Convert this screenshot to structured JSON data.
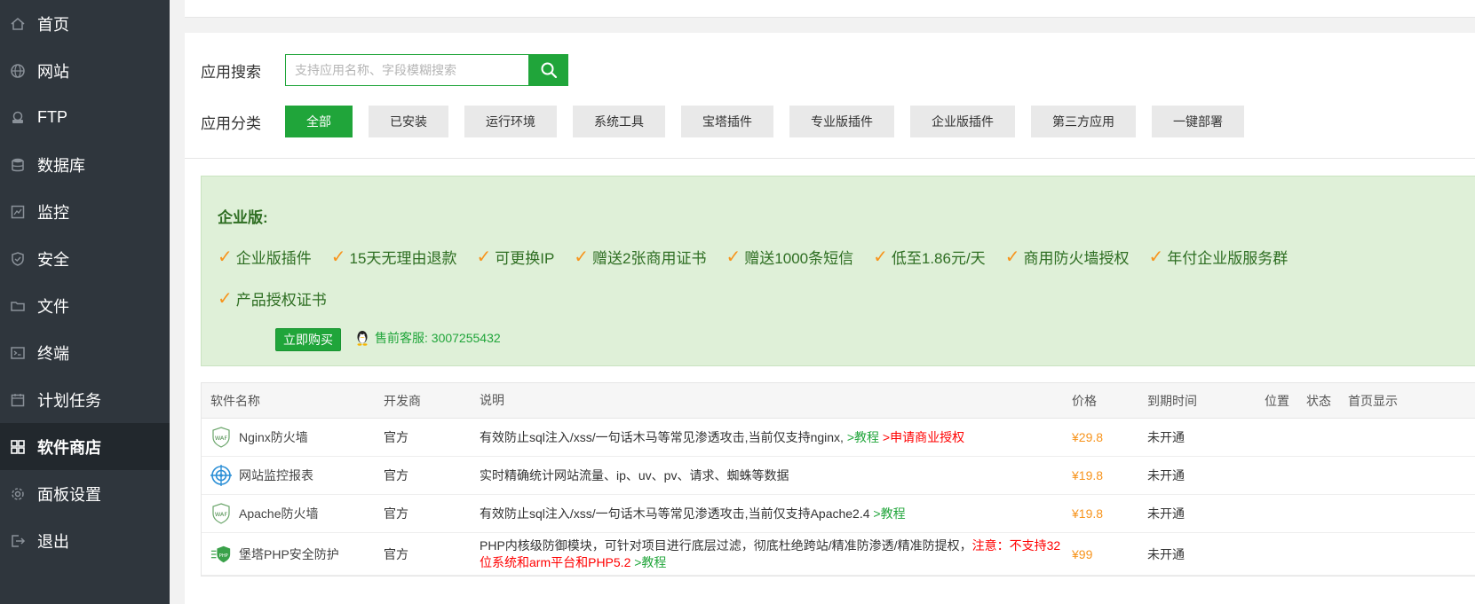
{
  "sidebar": {
    "items": [
      {
        "label": "首页",
        "icon": "home-icon",
        "key": "home"
      },
      {
        "label": "网站",
        "icon": "globe-icon",
        "key": "website"
      },
      {
        "label": "FTP",
        "icon": "ftp-icon",
        "key": "ftp"
      },
      {
        "label": "数据库",
        "icon": "database-icon",
        "key": "database"
      },
      {
        "label": "监控",
        "icon": "monitor-icon",
        "key": "monitor"
      },
      {
        "label": "安全",
        "icon": "shield-icon",
        "key": "security"
      },
      {
        "label": "文件",
        "icon": "folder-icon",
        "key": "files"
      },
      {
        "label": "终端",
        "icon": "terminal-icon",
        "key": "terminal"
      },
      {
        "label": "计划任务",
        "icon": "calendar-icon",
        "key": "crontab"
      },
      {
        "label": "软件商店",
        "icon": "grid-icon",
        "key": "store",
        "active": true
      },
      {
        "label": "面板设置",
        "icon": "gear-icon",
        "key": "settings"
      },
      {
        "label": "退出",
        "icon": "logout-icon",
        "key": "logout"
      }
    ]
  },
  "search": {
    "label": "应用搜索",
    "placeholder": "支持应用名称、字段模糊搜索",
    "value": ""
  },
  "categories": {
    "label": "应用分类",
    "items": [
      "全部",
      "已安装",
      "运行环境",
      "系统工具",
      "宝塔插件",
      "专业版插件",
      "企业版插件",
      "第三方应用",
      "一键部署"
    ],
    "active_index": 0
  },
  "promo": {
    "title": "企业版:",
    "features_line1": [
      "企业版插件",
      "15天无理由退款",
      "可更换IP",
      "赠送2张商用证书",
      "赠送1000条短信",
      "低至1.86元/天",
      "商用防火墙授权",
      "年付企业版服务群"
    ],
    "features_line2": [
      "产品授权证书"
    ],
    "buy_label": "立即购买",
    "presale_text": "售前客服: 3007255432"
  },
  "table": {
    "headers": {
      "name": "软件名称",
      "developer": "开发商",
      "description": "说明",
      "price": "价格",
      "expire": "到期时间",
      "position": "位置",
      "status": "状态",
      "home": "首页显示"
    },
    "rows": [
      {
        "name": "Nginx防火墙",
        "icon": "waf-icon",
        "developer": "官方",
        "description": "有效防止sql注入/xss/一句话木马等常见渗透攻击,当前仅支持nginx,",
        "link1": ">教程",
        "link2": ">申请商业授权",
        "price": "¥29.8",
        "expire": "未开通"
      },
      {
        "name": "网站监控报表",
        "icon": "target-icon",
        "developer": "官方",
        "description": "实时精确统计网站流量、ip、uv、pv、请求、蜘蛛等数据",
        "link1": "",
        "link2": "",
        "price": "¥19.8",
        "expire": "未开通"
      },
      {
        "name": "Apache防火墙",
        "icon": "waf-icon",
        "developer": "官方",
        "description": "有效防止sql注入/xss/一句话木马等常见渗透攻击,当前仅支持Apache2.4",
        "link1": ">教程",
        "link2": "",
        "price": "¥19.8",
        "expire": "未开通"
      },
      {
        "name": "堡塔PHP安全防护",
        "icon": "php-shield-icon",
        "developer": "官方",
        "description": "PHP内核级防御模块，可针对项目进行底层过滤，彻底杜绝跨站/精准防渗透/精准防提权，",
        "warning": "注意：不支持32位系统和arm平台和PHP5.2",
        "link1": ">教程",
        "link2": "",
        "price": "¥99",
        "expire": "未开通"
      }
    ]
  },
  "colors": {
    "accent": "#20a53a",
    "sidebar_bg": "#2f363d",
    "price": "#f7941d",
    "check": "#f7941d",
    "promo_bg": "#dff0d8",
    "warning": "#ff0000"
  }
}
